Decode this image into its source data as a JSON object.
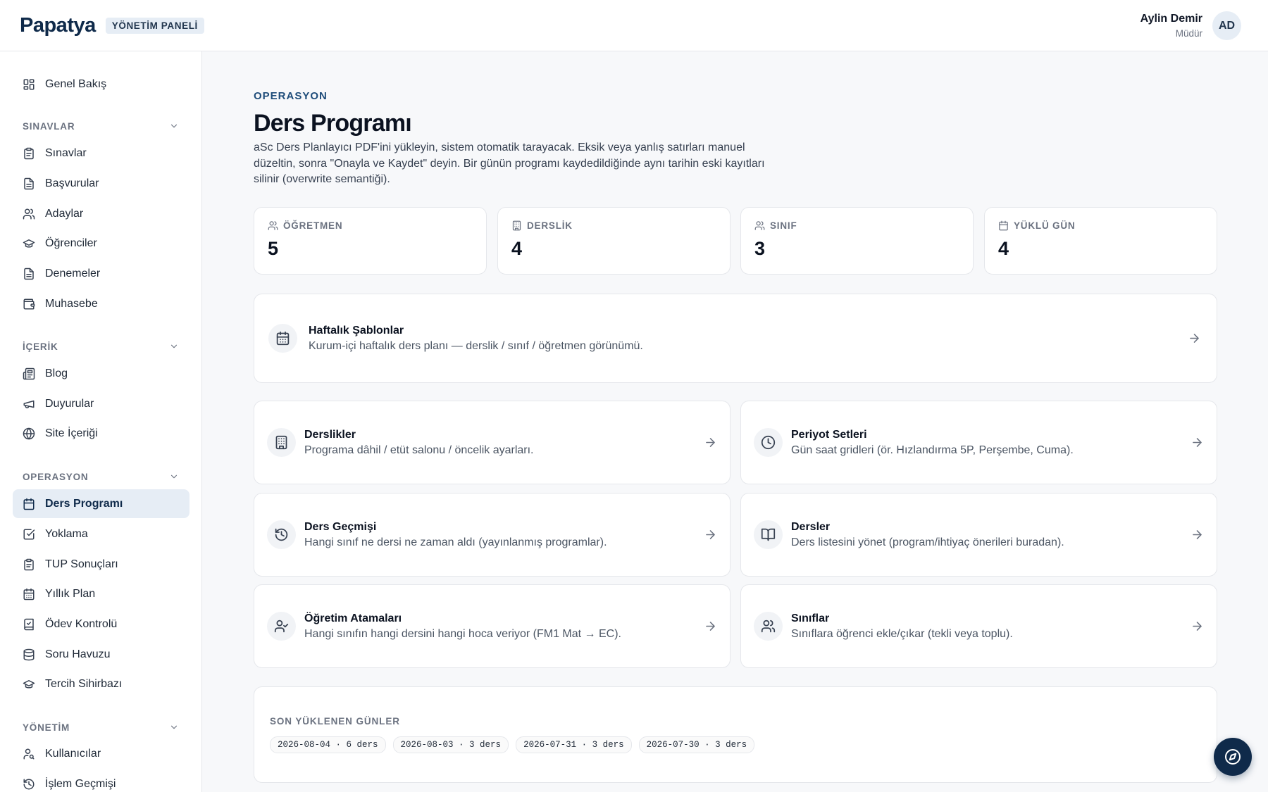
{
  "header": {
    "brand": "Papatya",
    "badge": "YÖNETİM PANELİ",
    "user_name": "Aylin Demir",
    "user_role": "Müdür",
    "avatar_initials": "AD"
  },
  "sidebar": {
    "overview": "Genel Bakış",
    "sections": [
      {
        "title": "SINAVLAR",
        "items": [
          "Sınavlar",
          "Başvurular",
          "Adaylar",
          "Öğrenciler",
          "Denemeler",
          "Muhasebe"
        ]
      },
      {
        "title": "İÇERİK",
        "items": [
          "Blog",
          "Duyurular",
          "Site İçeriği"
        ]
      },
      {
        "title": "OPERASYON",
        "items": [
          "Ders Programı",
          "Yoklama",
          "TUP Sonuçları",
          "Yıllık Plan",
          "Ödev Kontrolü",
          "Soru Havuzu",
          "Tercih Sihirbazı"
        ]
      },
      {
        "title": "YÖNETİM",
        "items": [
          "Kullanıcılar",
          "İşlem Geçmişi"
        ]
      }
    ],
    "active_item": "Ders Programı"
  },
  "page": {
    "eyebrow": "OPERASYON",
    "title": "Ders Programı",
    "description": "aSc Ders Planlayıcı PDF'ini yükleyin, sistem otomatik tarayacak. Eksik veya yanlış satırları manuel düzeltin, sonra \"Onayla ve Kaydet\" deyin. Bir günün programı kaydedildiğinde aynı tarihin eski kayıtları silinir (overwrite semantiği)."
  },
  "stats": [
    {
      "label": "ÖĞRETMEN",
      "value": "5",
      "icon": "users-icon"
    },
    {
      "label": "DERSLİK",
      "value": "4",
      "icon": "building-icon"
    },
    {
      "label": "SINIF",
      "value": "3",
      "icon": "users-icon"
    },
    {
      "label": "YÜKLÜ GÜN",
      "value": "4",
      "icon": "calendar-icon"
    }
  ],
  "feature_card": {
    "title": "Haftalık Şablonlar",
    "desc": "Kurum-içi haftalık ders planı — derslik / sınıf / öğretmen görünümü."
  },
  "cards": [
    {
      "title": "Derslikler",
      "desc": "Programa dâhil / etüt salonu / öncelik ayarları.",
      "icon": "building-icon"
    },
    {
      "title": "Periyot Setleri",
      "desc": "Gün saat gridleri (ör. Hızlandırma 5P, Perşembe, Cuma).",
      "icon": "clock-icon"
    },
    {
      "title": "Ders Geçmişi",
      "desc": "Hangi sınıf ne dersi ne zaman aldı (yayınlanmış programlar).",
      "icon": "history-icon"
    },
    {
      "title": "Dersler",
      "desc": "Ders listesini yönet (program/ihtiyaç önerileri buradan).",
      "icon": "book-icon"
    },
    {
      "title": "Öğretim Atamaları",
      "desc": "Hangi sınıfın hangi dersini hangi hoca veriyor (FM1 Mat → EC).",
      "icon": "user-check-icon"
    },
    {
      "title": "Sınıflar",
      "desc": "Sınıflara öğrenci ekle/çıkar (tekli veya toplu).",
      "icon": "users-icon"
    }
  ],
  "recent": {
    "title": "SON YÜKLENEN GÜNLER",
    "chips": [
      "2026-08-04 · 6 ders",
      "2026-08-03 · 3 ders",
      "2026-07-31 · 3 ders",
      "2026-07-30 · 3 ders"
    ]
  }
}
